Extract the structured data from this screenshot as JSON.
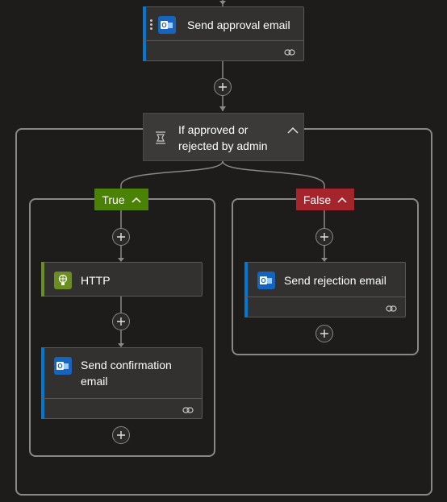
{
  "canvas": {
    "top_action": {
      "title": "Send approval email",
      "icon": "outlook-icon"
    },
    "condition": {
      "title": "If approved or rejected by admin",
      "icon": "condition-icon"
    },
    "true_branch": {
      "label": "True",
      "color": "#498205",
      "actions": [
        {
          "title": "HTTP",
          "icon": "http-icon"
        },
        {
          "title": "Send confirmation email",
          "icon": "outlook-icon"
        }
      ]
    },
    "false_branch": {
      "label": "False",
      "color": "#a4262c",
      "actions": [
        {
          "title": "Send rejection email",
          "icon": "outlook-icon"
        }
      ]
    }
  },
  "colors": {
    "background": "#1d1c1b",
    "card": "#323130",
    "accent_blue": "#0078d4",
    "accent_green": "#6b8e23"
  }
}
